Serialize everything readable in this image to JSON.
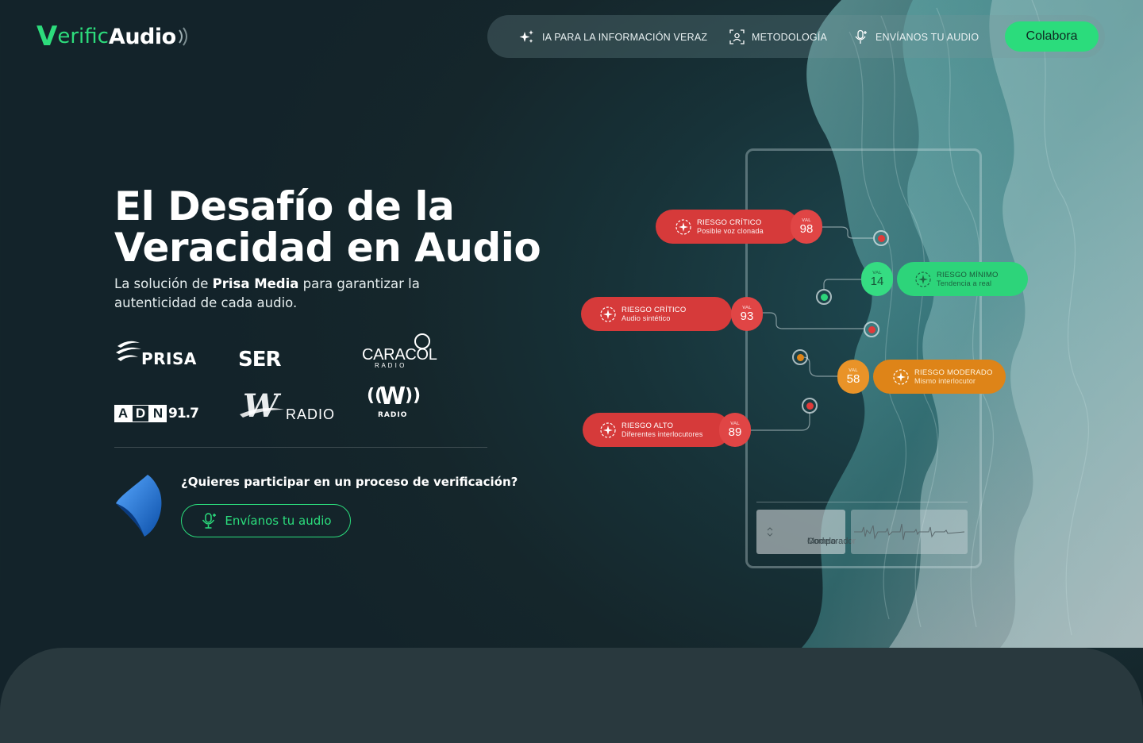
{
  "brand": {
    "logo_v": "V",
    "logo_erific": "erific",
    "logo_audio": "Audio"
  },
  "nav": {
    "items": [
      {
        "label": "IA PARA LA INFORMACIÓN VERAZ",
        "icon": "sparkles-icon"
      },
      {
        "label": "METODOLOGÍA",
        "icon": "face-scan-icon"
      },
      {
        "label": "ENVÍANOS TU AUDIO",
        "icon": "microphone-plus-icon"
      }
    ],
    "cta_label": "Colabora"
  },
  "hero": {
    "title_line1": "El Desafío de la",
    "title_line2": "Veracidad en Audio",
    "subtitle_pre": "La solución de ",
    "subtitle_bold": "Prisa Media",
    "subtitle_post": " para garantizar la autenticidad de cada audio."
  },
  "brands": {
    "prisa": "PRISA",
    "ser": "SER",
    "caracol": "CARACOL",
    "caracol_sub": "R A D I O",
    "adn_letters": [
      "A",
      "D",
      "N"
    ],
    "adn_freq": "91.7",
    "wradio_w": "W",
    "wradio_radio": "RADIO",
    "wradio2_w": "W",
    "wradio2_radio": "RADIO"
  },
  "participate": {
    "question": "¿Quieres participar en un proceso de verificación?",
    "button_label": "Envíanos tu audio"
  },
  "risk_cards": [
    {
      "title": "RIESGO CRÍTICO",
      "subtitle": "Posible voz clonada",
      "val_label": "VAL",
      "value": 98,
      "level": "critical"
    },
    {
      "title": "RIESGO MÍNIMO",
      "subtitle": "Tendencia a real",
      "val_label": "VAL",
      "value": 14,
      "level": "minimal"
    },
    {
      "title": "RIESGO CRÍTICO",
      "subtitle": "Audio sintético",
      "val_label": "VAL",
      "value": 93,
      "level": "critical"
    },
    {
      "title": "RIESGO MODERADO",
      "subtitle": "Mismo interlocutor",
      "val_label": "VAL",
      "value": 58,
      "level": "moderate"
    },
    {
      "title": "RIESGO ALTO",
      "subtitle": "Diferentes interlocutores",
      "val_label": "VAL",
      "value": 89,
      "level": "high"
    }
  ],
  "model_selector": {
    "line1": "Modelo",
    "line2": "Comparador"
  },
  "colors": {
    "accent": "#2bdc7c",
    "critical": "#d63a3a",
    "moderate": "#de8418",
    "minimal": "#2dd47a"
  }
}
